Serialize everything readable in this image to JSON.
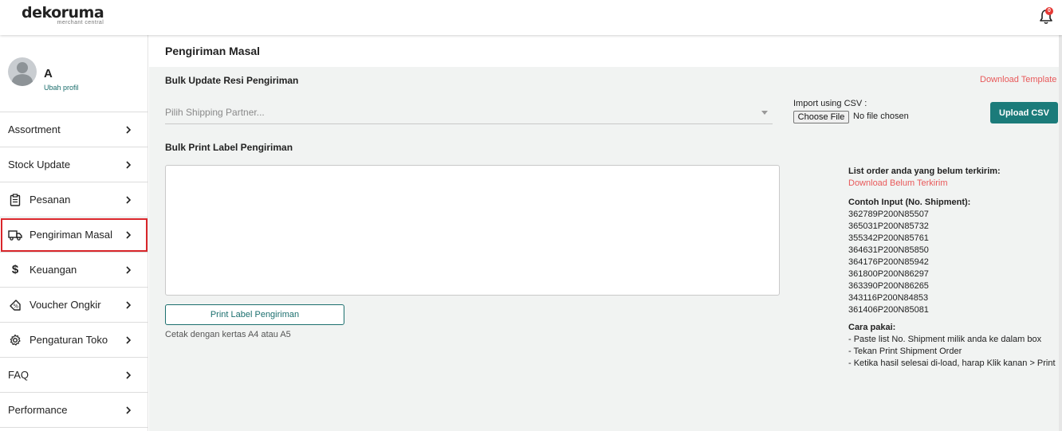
{
  "brand": {
    "name": "dekoruma",
    "subtitle": "merchant central"
  },
  "notifications": {
    "count": "0"
  },
  "profile": {
    "name": "A",
    "edit_link": "Ubah profil"
  },
  "sidebar": {
    "items": [
      {
        "label": "Assortment",
        "icon": ""
      },
      {
        "label": "Stock Update",
        "icon": ""
      },
      {
        "label": "Pesanan",
        "icon": "clipboard-icon"
      },
      {
        "label": "Pengiriman Masal",
        "icon": "truck-icon"
      },
      {
        "label": "Keuangan",
        "icon": "dollar-icon"
      },
      {
        "label": "Voucher Ongkir",
        "icon": "voucher-tag-icon"
      },
      {
        "label": "Pengaturan Toko",
        "icon": "gear-icon"
      },
      {
        "label": "FAQ",
        "icon": ""
      },
      {
        "label": "Performance",
        "icon": ""
      }
    ],
    "highlight_color": "#d9262b"
  },
  "main": {
    "title": "Pengiriman Masal",
    "bulk_update": {
      "title": "Bulk Update Resi Pengiriman",
      "download_template": "Download Template",
      "shipping_placeholder": "Pilih Shipping Partner...",
      "import_label": "Import using CSV :",
      "choose_file": "Choose File",
      "no_file": "No file chosen",
      "upload_button": "Upload CSV"
    },
    "bulk_print": {
      "title": "Bulk Print Label Pengiriman",
      "print_button": "Print Label Pengiriman",
      "note": "Cetak dengan kertas A4 atau A5"
    },
    "info": {
      "pending_title": "List order anda yang belum terkirim:",
      "pending_link": "Download Belum Terkirim",
      "example_title": "Contoh Input (No. Shipment):",
      "examples": [
        "362789P200N85507",
        "365031P200N85732",
        "355342P200N85761",
        "364631P200N85850",
        "364176P200N85942",
        "361800P200N86297",
        "363390P200N86265",
        "343116P200N84853",
        "361406P200N85081"
      ],
      "usage_title": "Cara pakai:",
      "usage_steps": [
        "- Paste list No. Shipment milik anda ke dalam box",
        "- Tekan Print Shipment Order",
        "- Ketika hasil selesai di-load, harap Klik kanan > Print"
      ]
    }
  },
  "colors": {
    "accent": "#1b7b7a",
    "link_red": "#e8595a",
    "badge": "#e53935"
  }
}
